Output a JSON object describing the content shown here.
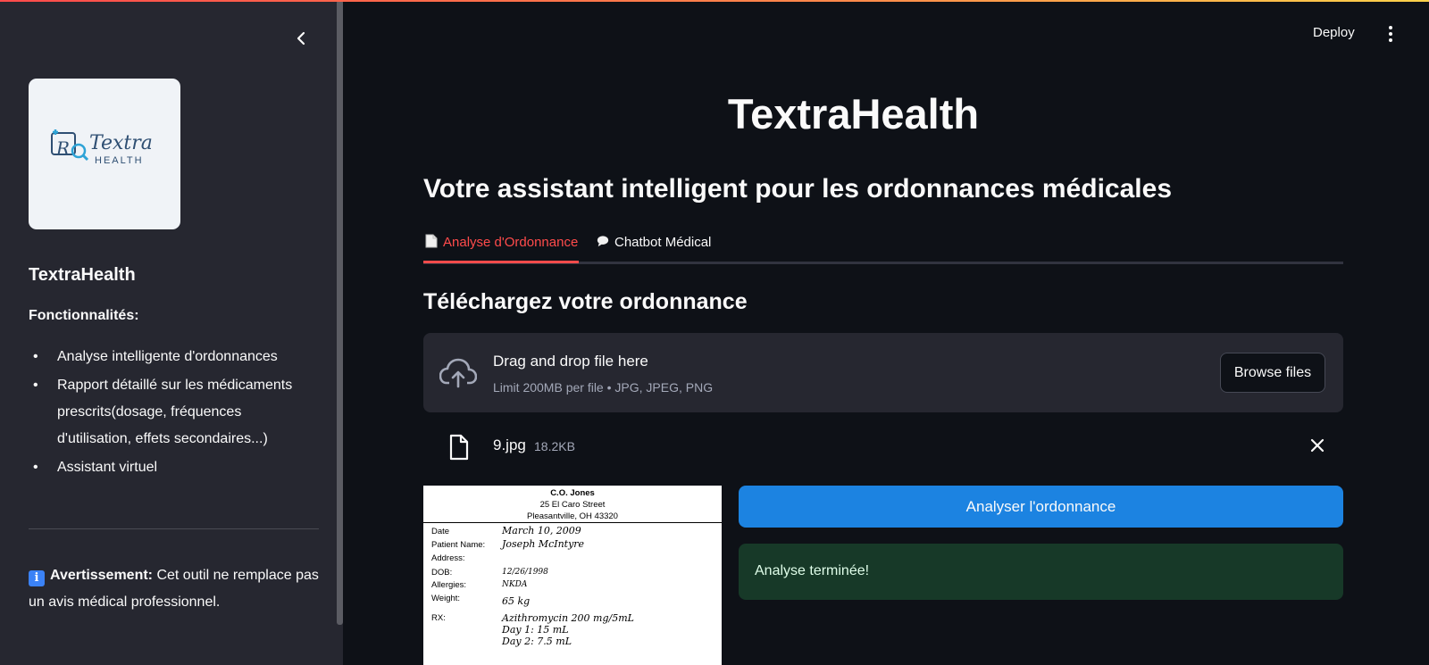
{
  "sidebar": {
    "logo_alt": "Textra HEALTH",
    "title": "TextraHealth",
    "features_heading": "Fonctionnalités:",
    "features": [
      "Analyse intelligente d'ordonnances",
      "Rapport détaillé sur les médicaments prescrits(dosage, fréquences d'utilisation, effets secondaires...)",
      "Assistant virtuel"
    ],
    "warning_label": "Avertissement:",
    "warning_text": " Cet outil ne remplace pas un avis médical professionnel."
  },
  "header": {
    "deploy_label": "Deploy"
  },
  "main": {
    "title": "TextraHealth",
    "subtitle": "Votre assistant intelligent pour les ordonnances médicales",
    "tabs": [
      {
        "label": "Analyse d'Ordonnance",
        "active": true
      },
      {
        "label": "Chatbot Médical",
        "active": false
      }
    ],
    "upload_heading": "Téléchargez votre ordonnance",
    "dropzone": {
      "main_text": "Drag and drop file here",
      "hint_text": "Limit 200MB per file • JPG, JPEG, PNG",
      "browse_label": "Browse files"
    },
    "uploaded_file": {
      "name": "9.jpg",
      "size": "18.2KB"
    },
    "prescription": {
      "doctor": "C.O. Jones",
      "street": "25 El Caro Street",
      "city": "Pleasantville, OH 43320",
      "date_label": "Date",
      "date_value": "March 10, 2009",
      "patient_label": "Patient Name:",
      "patient_value": "Joseph McIntyre",
      "address_label": "Address:",
      "dob_label": "DOB:",
      "dob_value": "12/26/1998",
      "allergies_label": "Allergies:",
      "allergies_value": "NKDA",
      "weight_label": "Weight:",
      "weight_value": "65 kg",
      "rx_label": "RX:",
      "rx_line1": "Azithromycin 200 mg/5mL",
      "rx_line2": "Day 1: 15 mL",
      "rx_line3": "Day 2: 7.5 mL"
    },
    "analyze_label": "Analyser l'ordonnance",
    "success_text": "Analyse terminée!"
  },
  "colors": {
    "accent": "#ff4b4b",
    "primary_button": "#1c83e1",
    "success_bg": "#173928",
    "sidebar_bg": "#262730",
    "main_bg": "#0e1117"
  }
}
